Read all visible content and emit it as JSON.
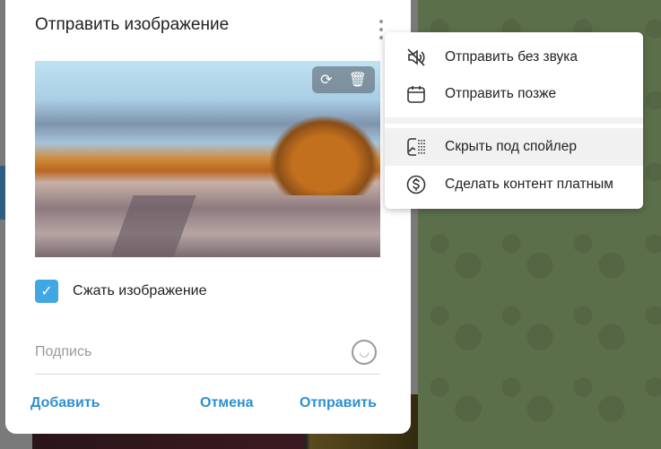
{
  "dialog": {
    "title": "Отправить изображение",
    "compress_label": "Сжать изображение",
    "compress_checked": true,
    "caption_placeholder": "Подпись",
    "caption_value": "",
    "add_label": "Добавить",
    "cancel_label": "Отмена",
    "send_label": "Отправить"
  },
  "menu": {
    "items": [
      {
        "label": "Отправить без звука",
        "icon": "muted-icon"
      },
      {
        "label": "Отправить позже",
        "icon": "calendar-icon"
      },
      {
        "label": "Скрыть под спойлер",
        "icon": "spoiler-icon"
      },
      {
        "label": "Сделать контент платным",
        "icon": "dollar-icon"
      }
    ]
  },
  "colors": {
    "accent": "#40a7e3",
    "link": "#2c8fd0"
  }
}
